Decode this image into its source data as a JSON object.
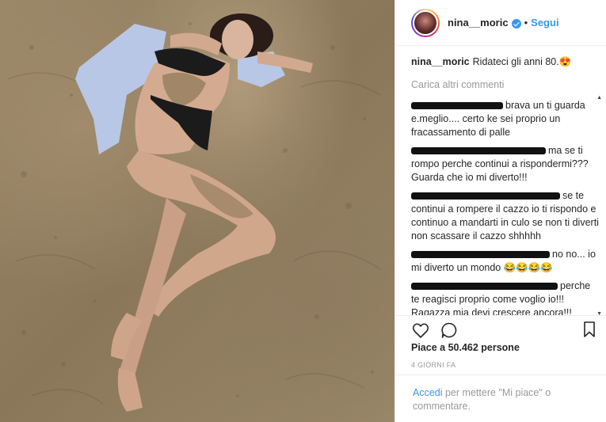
{
  "post": {
    "username": "nina__moric",
    "follow_label": "Segui",
    "dot": "•"
  },
  "caption": {
    "username": "nina__moric",
    "text": "Ridateci gli anni 80.😍"
  },
  "load_more": "Carica altri commenti",
  "comments": [
    {
      "text": "brava un ti guarda e.meglio.... certo ke sei proprio un fracassamento di palle"
    },
    {
      "text": "ma se ti rompo perche continui a rispondermi??? Guarda che io mi diverto!!!"
    },
    {
      "text": "se te continui a rompere il cazzo io ti rispondo e continuo a mandarti in culo se non ti diverti non scassare il cazzo shhhhh"
    },
    {
      "text": "no no... io mi diverto un mondo 😂😂😂😂"
    },
    {
      "text": "perche te reagisci proprio come voglio io!!! Ragazza mia devi crescere ancora!!!"
    }
  ],
  "likes": "Piace a 50.462 persone",
  "time_ago": "4 GIORNI FA",
  "footer": {
    "login_label": "Accedi",
    "rest": "per mettere \"Mi piace\" o commentare."
  },
  "icons": {
    "heart": "heart-icon",
    "comment": "comment-icon",
    "bookmark": "bookmark-icon",
    "verified": "verified-badge-icon"
  },
  "colors": {
    "accent": "#3897f0",
    "text": "#262626",
    "muted": "#999999",
    "border": "#efefef"
  }
}
